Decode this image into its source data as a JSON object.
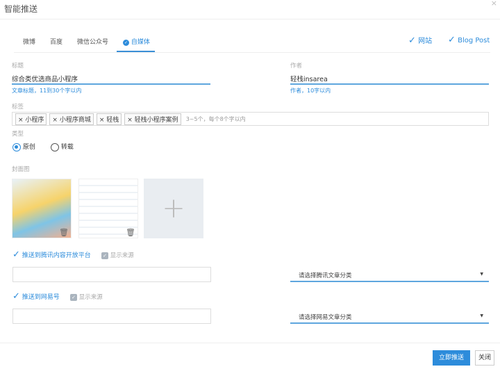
{
  "dialog": {
    "title": "智能推送",
    "close": "×"
  },
  "tabs": [
    {
      "label": "微博"
    },
    {
      "label": "百度"
    },
    {
      "label": "微信公众号"
    },
    {
      "label": "自媒体",
      "active": true
    }
  ],
  "targets": [
    {
      "label": "网站"
    },
    {
      "label": "Blog Post"
    }
  ],
  "form": {
    "title_label": "标题",
    "title_value": "综合类优选商品小程序",
    "title_hint": "文章标题，11到30个字以内",
    "author_label": "作者",
    "author_value": "轻栈insarea",
    "author_hint": "作者，10字以内",
    "tags_label": "标签",
    "tags": [
      "小程序",
      "小程序商城",
      "轻栈",
      "轻栈小程序案例"
    ],
    "tags_placeholder": "3~5个，每个8个字以内",
    "type_label": "类型",
    "type_options": [
      "原创",
      "转载"
    ],
    "type_selected": "原创",
    "cover_label": "封面图"
  },
  "push": [
    {
      "label": "推送到腾讯内容开放平台",
      "show_source": "显示来源",
      "select_placeholder": "请选择腾讯文章分类"
    },
    {
      "label": "推送到网易号",
      "show_source": "显示来源",
      "select_placeholder": "请选择网易文章分类"
    }
  ],
  "footer": {
    "submit": "立即推送",
    "close": "关闭"
  },
  "colors": {
    "accent": "#2d8cdb"
  }
}
